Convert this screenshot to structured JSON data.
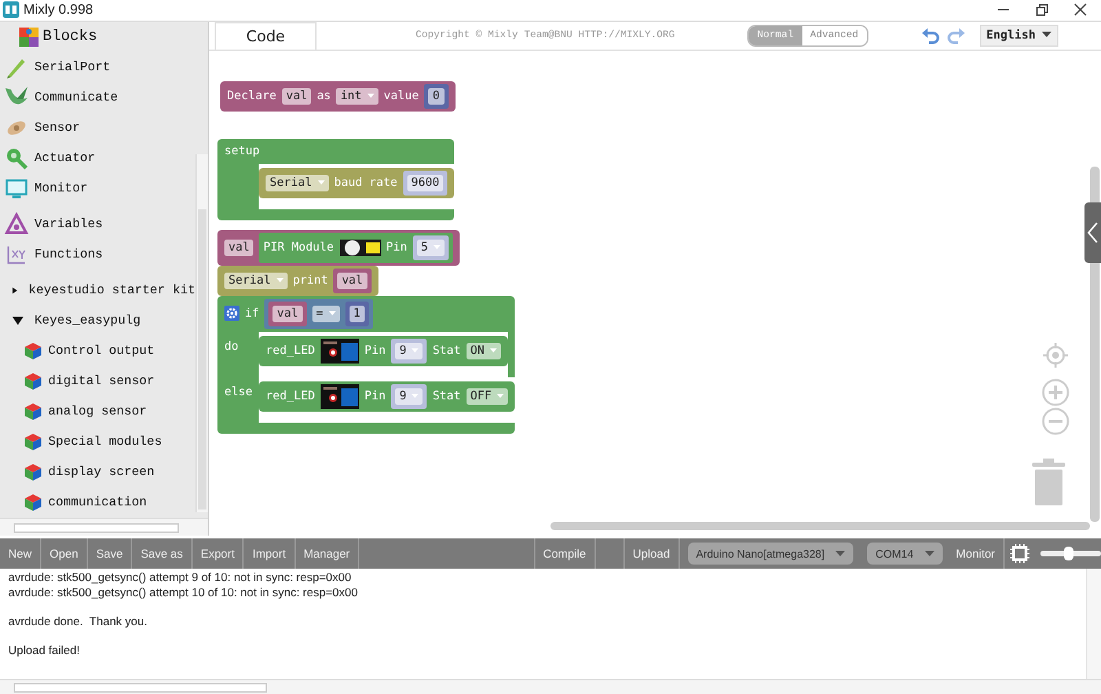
{
  "window": {
    "title": "Mixly 0.998"
  },
  "sidebar": {
    "header": "Blocks",
    "categories": [
      {
        "label": "SerialPort"
      },
      {
        "label": "Communicate"
      },
      {
        "label": "Sensor"
      },
      {
        "label": "Actuator"
      },
      {
        "label": "Monitor"
      }
    ],
    "extras": [
      {
        "label": "Variables"
      },
      {
        "label": "Functions"
      }
    ],
    "tree": [
      {
        "label": "keyestudio starter kit",
        "expanded": false
      },
      {
        "label": "Keyes_easypulg",
        "expanded": true,
        "children": [
          {
            "label": "Control output"
          },
          {
            "label": "digital sensor"
          },
          {
            "label": "analog sensor"
          },
          {
            "label": "Special modules"
          },
          {
            "label": "display screen"
          },
          {
            "label": "communication"
          }
        ]
      }
    ]
  },
  "header": {
    "tab": "Code",
    "copyright": "Copyright © Mixly Team@BNU HTTP://MIXLY.ORG",
    "modes": [
      {
        "label": "Normal",
        "selected": true
      },
      {
        "label": "Advanced",
        "selected": false
      }
    ],
    "language": "English"
  },
  "workspace": {
    "stacks": [
      {
        "blocks": [
          {
            "color": "#a55b80",
            "tokens": [
              {
                "kind": "label",
                "text": "Declare"
              },
              {
                "kind": "field",
                "text": "val"
              },
              {
                "kind": "label",
                "text": "as"
              },
              {
                "kind": "dropdown",
                "text": "int"
              },
              {
                "kind": "label",
                "text": "value"
              },
              {
                "kind": "block",
                "color": "#5b67a5",
                "tokens": [
                  {
                    "kind": "field",
                    "text": "0"
                  }
                ]
              }
            ]
          }
        ]
      },
      {
        "blocks": [
          {
            "color": "#5ba55b",
            "tokens": [
              {
                "kind": "label",
                "text": "setup"
              }
            ],
            "sections": [
              {
                "blocks": [
                  {
                    "color": "#a5a55b",
                    "tokens": [
                      {
                        "kind": "dropdown",
                        "text": "Serial"
                      },
                      {
                        "kind": "label",
                        "text": "baud rate"
                      },
                      {
                        "kind": "block",
                        "color": "#b8bedc",
                        "tokens": [
                          {
                            "kind": "field",
                            "text": "9600"
                          }
                        ]
                      }
                    ]
                  }
                ]
              }
            ]
          }
        ]
      },
      {
        "blocks": [
          {
            "color": "#a55b80",
            "tokens": [
              {
                "kind": "field",
                "text": "val"
              },
              {
                "kind": "block",
                "color": "#5ba55b",
                "tokens": [
                  {
                    "kind": "label",
                    "text": "PIR Module"
                  },
                  {
                    "kind": "pir-image"
                  },
                  {
                    "kind": "label",
                    "text": "Pin"
                  },
                  {
                    "kind": "block",
                    "color": "#b8bedc",
                    "tokens": [
                      {
                        "kind": "dropdown",
                        "text": "5"
                      }
                    ]
                  }
                ]
              }
            ]
          },
          {
            "color": "#a5a55b",
            "tokens": [
              {
                "kind": "dropdown",
                "text": "Serial"
              },
              {
                "kind": "label",
                "text": "print"
              },
              {
                "kind": "block",
                "color": "#a55b80",
                "tokens": [
                  {
                    "kind": "field",
                    "text": "val"
                  }
                ]
              }
            ]
          },
          {
            "color": "#5ba55b",
            "tokens": [
              {
                "kind": "mutator"
              },
              {
                "kind": "label",
                "text": "if"
              },
              {
                "kind": "block",
                "color": "#5b80a5",
                "tokens": [
                  {
                    "kind": "block",
                    "color": "#a55b80",
                    "tokens": [
                      {
                        "kind": "field",
                        "text": "val"
                      }
                    ]
                  },
                  {
                    "kind": "dropdown",
                    "text": "="
                  },
                  {
                    "kind": "block",
                    "color": "#5b67a5",
                    "tokens": [
                      {
                        "kind": "field",
                        "text": "1"
                      }
                    ]
                  }
                ]
              }
            ],
            "sections": [
              {
                "label": "do",
                "blocks": [
                  {
                    "color": "#5ba55b",
                    "tokens": [
                      {
                        "kind": "label",
                        "text": "red_LED"
                      },
                      {
                        "kind": "led-image"
                      },
                      {
                        "kind": "label",
                        "text": "Pin"
                      },
                      {
                        "kind": "block",
                        "color": "#b8bedc",
                        "tokens": [
                          {
                            "kind": "dropdown",
                            "text": "9"
                          }
                        ]
                      },
                      {
                        "kind": "label",
                        "text": "Stat"
                      },
                      {
                        "kind": "dropdown",
                        "text": "ON"
                      }
                    ]
                  }
                ]
              },
              {
                "label": "else",
                "blocks": [
                  {
                    "color": "#5ba55b",
                    "tokens": [
                      {
                        "kind": "label",
                        "text": "red_LED"
                      },
                      {
                        "kind": "led-image"
                      },
                      {
                        "kind": "label",
                        "text": "Pin"
                      },
                      {
                        "kind": "block",
                        "color": "#b8bedc",
                        "tokens": [
                          {
                            "kind": "dropdown",
                            "text": "9"
                          }
                        ]
                      },
                      {
                        "kind": "label",
                        "text": "Stat"
                      },
                      {
                        "kind": "dropdown",
                        "text": "OFF"
                      }
                    ]
                  }
                ]
              }
            ]
          }
        ]
      }
    ]
  },
  "toolbar": {
    "left": [
      {
        "label": "New"
      },
      {
        "label": "Open"
      },
      {
        "label": "Save"
      },
      {
        "label": "Save as"
      },
      {
        "label": "Export"
      },
      {
        "label": "Import"
      },
      {
        "label": "Manager"
      }
    ],
    "right": [
      {
        "kind": "button",
        "label": "Compile"
      },
      {
        "kind": "blank"
      },
      {
        "kind": "button",
        "label": "Upload"
      },
      {
        "kind": "select",
        "value": "Arduino Nano[atmega328]"
      },
      {
        "kind": "select",
        "value": "COM14"
      },
      {
        "kind": "button",
        "label": "Monitor"
      },
      {
        "kind": "chip"
      },
      {
        "kind": "slider",
        "level": 0.45
      }
    ]
  },
  "console": {
    "paragraphs": [
      [
        "avrdude: stk500_getsync() attempt 9 of 10: not in sync: resp=0x00",
        "avrdude: stk500_getsync() attempt 10 of 10: not in sync: resp=0x00"
      ],
      [
        "avrdude done.  Thank you."
      ],
      [
        "Upload failed!"
      ]
    ]
  }
}
